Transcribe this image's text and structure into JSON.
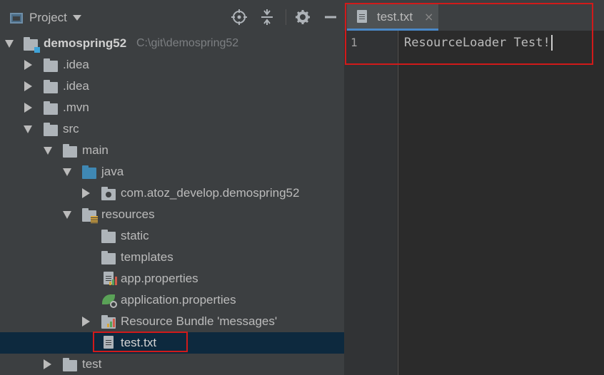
{
  "project_panel": {
    "title": "Project",
    "tree": [
      {
        "label": "demospring52",
        "path": "C:\\git\\demospring52",
        "bold": true
      },
      {
        "label": ".idea"
      },
      {
        "label": ".idea"
      },
      {
        "label": ".mvn"
      },
      {
        "label": "src"
      },
      {
        "label": "main"
      },
      {
        "label": "java"
      },
      {
        "label": "com.atoz_develop.demospring52"
      },
      {
        "label": "resources"
      },
      {
        "label": "static"
      },
      {
        "label": "templates"
      },
      {
        "label": "app.properties"
      },
      {
        "label": "application.properties"
      },
      {
        "label": "Resource Bundle 'messages'"
      },
      {
        "label": "test.txt",
        "selected": true
      },
      {
        "label": "test"
      }
    ]
  },
  "editor": {
    "tab_label": "test.txt",
    "tab_close": "×",
    "line_number": "1",
    "code_line": "ResourceLoader Test!"
  },
  "colors": {
    "highlight_border": "#d11a1a",
    "selection": "#0d293e",
    "tab_accent": "#4a88c7"
  }
}
